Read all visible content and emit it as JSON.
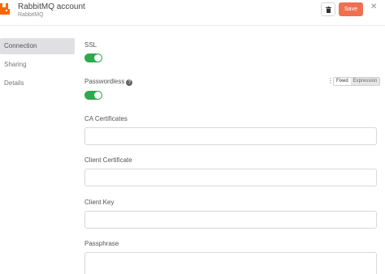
{
  "header": {
    "title": "RabbitMQ account",
    "subtitle": "RabbitMQ",
    "save_label": "Save",
    "logo_icon": "rabbitmq-logo",
    "delete_icon": "trash-icon",
    "close_icon": "close-icon"
  },
  "sidebar": {
    "items": [
      {
        "label": "Connection",
        "active": true
      },
      {
        "label": "Sharing",
        "active": false
      },
      {
        "label": "Details",
        "active": false
      }
    ]
  },
  "form": {
    "ssl": {
      "label": "SSL",
      "value": true
    },
    "passwordless": {
      "label": "Passwordless",
      "value": true,
      "mode_options": [
        "Fixed",
        "Expression"
      ],
      "mode_selected": "Fixed"
    },
    "ca_certificates": {
      "label": "CA Certificates",
      "value": ""
    },
    "client_certificate": {
      "label": "Client Certificate",
      "value": ""
    },
    "client_key": {
      "label": "Client Key",
      "value": ""
    },
    "passphrase": {
      "label": "Passphrase",
      "value": ""
    }
  },
  "colors": {
    "accent": "#ee7050",
    "toggle_on": "#2fa94d",
    "logo": "#ff6600"
  }
}
